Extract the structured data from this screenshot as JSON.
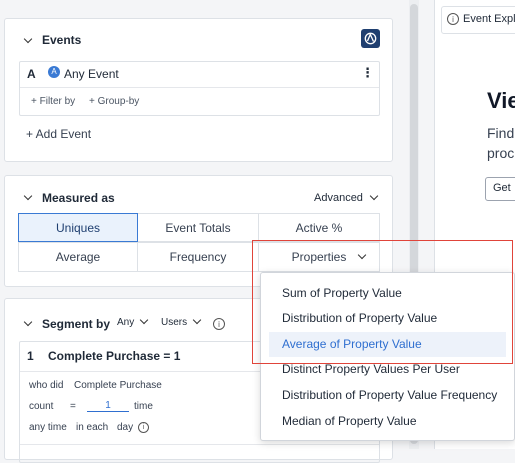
{
  "events": {
    "title": "Events",
    "event_letter": "A",
    "event_name": "Any Event",
    "filter_by": "+ Filter by",
    "group_by": "+ Group-by",
    "add_event": "+ Add Event",
    "more_label": "⋮"
  },
  "measured_as": {
    "title": "Measured as",
    "advanced": "Advanced",
    "options": [
      "Uniques",
      "Event Totals",
      "Active %",
      "Average",
      "Frequency",
      "Properties"
    ],
    "selected": "Uniques"
  },
  "properties_dropdown": {
    "items": [
      "Sum of Property Value",
      "Distribution of Property Value",
      "Average of Property Value",
      "Distinct Property Values Per User",
      "Distribution of Property Value Frequency",
      "Median of Property Value"
    ],
    "highlighted": "Average of Property Value"
  },
  "segment": {
    "title": "Segment by",
    "any": "Any",
    "users": "Users",
    "number": "1",
    "name": "Complete Purchase = 1",
    "who_did": "who did",
    "event": "Complete Purchase",
    "count_label": "count",
    "operator": "=",
    "count_value": "1",
    "time_label": "time",
    "any_time": "any time",
    "in_each": "in each",
    "day": "day",
    "info": "i"
  },
  "right_panel": {
    "tab": "Event Expl",
    "heading": "Vie",
    "text_line1": "Find",
    "text_line2": "proc",
    "button": "Get"
  },
  "colors": {
    "accent": "#2f6fd0",
    "highlight_border": "#e0443a",
    "selected_bg": "#eaf2fc"
  }
}
